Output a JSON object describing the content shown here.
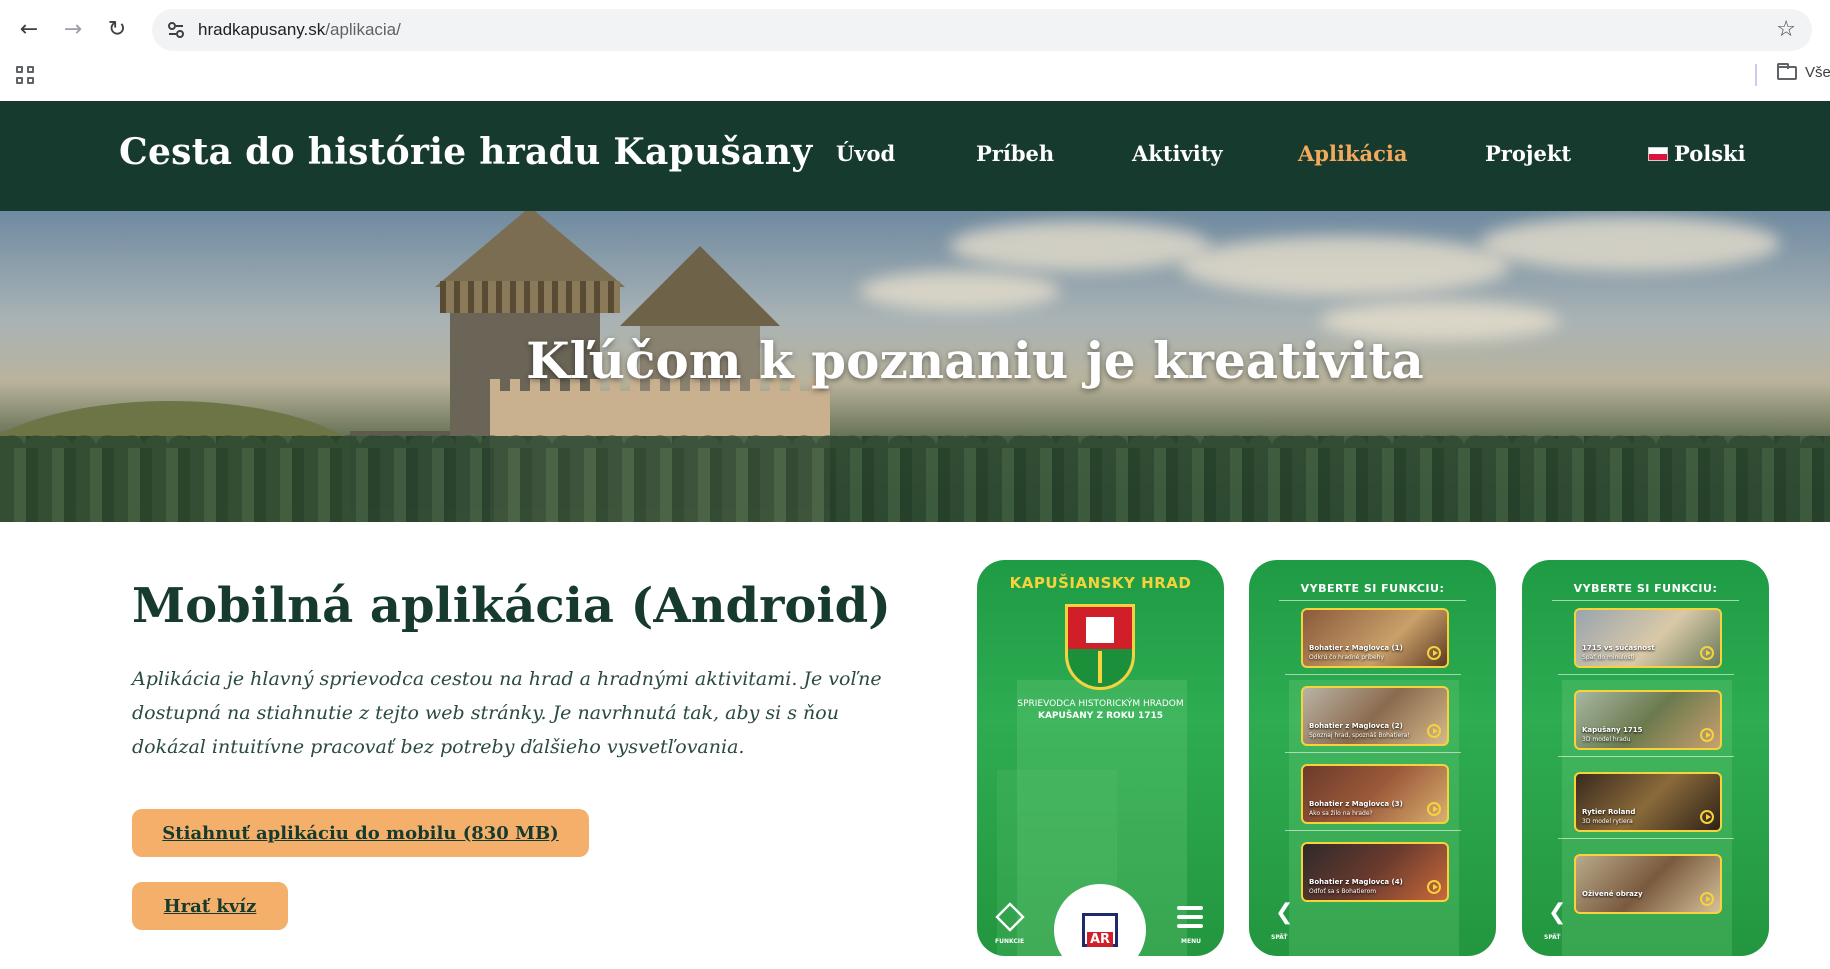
{
  "browser": {
    "url_host": "hradkapusany.sk",
    "url_path": "/aplikacia/",
    "bookmarks_folder": "Vše"
  },
  "site": {
    "title": "Cesta do histórie hradu Kapušany",
    "nav": [
      {
        "label": "Úvod"
      },
      {
        "label": "Príbeh"
      },
      {
        "label": "Aktivity"
      },
      {
        "label": "Aplikácia",
        "active": true
      },
      {
        "label": "Projekt"
      },
      {
        "label": "Polski"
      }
    ],
    "accent_color": "#f3a95b",
    "header_color": "#173a2e"
  },
  "hero": {
    "heading": "Kľúčom k poznaniu je kreativita"
  },
  "main": {
    "title": "Mobilná aplikácia (Android)",
    "description": "Aplikácia je hlavný sprievodca cestou na hrad a hradnými aktivitami. Je voľne dostupná na stiahnutie z tejto web stránky. Je navrhnutá tak, aby si s ňou dokázal intuitívne pracovať bez potreby ďalšieho vysvetľovania.",
    "download_button": "Stiahnuť aplikáciu do mobilu (830 MB)",
    "quiz_button": "Hrať kvíz"
  },
  "phones": {
    "p1": {
      "title": "KAPUŠIANSKY HRAD",
      "subtitle_line1": "SPRIEVODCA HISTORICKÝM HRADOM",
      "subtitle_line2": "KAPUŠANY Z ROKU 1715",
      "funkcie_label": "FUNKCIE",
      "ar_label": "AR",
      "menu_label": "MENU"
    },
    "p2": {
      "heading": "VYBERTE SI FUNKCIU:",
      "back_label": "SPÄŤ",
      "cards": [
        {
          "title": "Bohatier z Maglovca (1)",
          "sub": "Odkrú čo hradné príbehy"
        },
        {
          "title": "Bohatier z Maglovca (2)",
          "sub": "Spoznaj hrad, spoznáš Bohatiera!"
        },
        {
          "title": "Bohatier z Maglovca (3)",
          "sub": "Ako sa žilo na hrade?"
        },
        {
          "title": "Bohatier z Maglovca (4)",
          "sub": "Odfoť sa s Bohatierom"
        }
      ]
    },
    "p3": {
      "heading": "VYBERTE SI FUNKCIU:",
      "back_label": "SPÄŤ",
      "cards": [
        {
          "title": "1715 vs súčasnosť",
          "sub": "Späť do minulosti"
        },
        {
          "title": "Kapušany 1715",
          "sub": "3D model hradu"
        },
        {
          "title": "Rytier Roland",
          "sub": "3D model rytiera"
        },
        {
          "title": "Oživené obrazy",
          "sub": ""
        }
      ]
    }
  }
}
